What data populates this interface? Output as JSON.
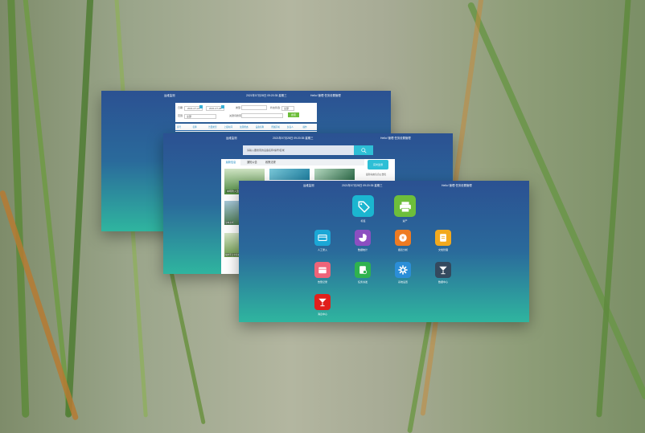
{
  "windows": {
    "back": {
      "brand": "运维监测",
      "datetime": "2021年07月28日 09:20:35 星期三",
      "user": "Hello! 管理  任务设置管理",
      "filters": {
        "date_label": "日期:",
        "date_from": "2021-07-21",
        "date_to": "2021-07-28",
        "type_label": "类型:",
        "status_label": "状态筛选:",
        "status_value": "全部",
        "scope_label": "范围:",
        "scope_value": "全部",
        "keyword_label": "关键词搜索:",
        "search_button": "搜索"
      },
      "columns": [
        "序号",
        "名称",
        "告警类型",
        "上报时间",
        "处理状态",
        "设备名称",
        "所属区域",
        "负责人",
        "操作"
      ]
    },
    "middle": {
      "brand": "运维监测",
      "datetime": "2021年07月28日 09:20:35 星期三",
      "user": "Hello! 管理  任务设置管理",
      "search_placeholder": "请输入要搜索的设备名称/编号/区域",
      "tabs": [
        "最新信息",
        "通知公告",
        "政策法规"
      ],
      "side_badge": "实时监测",
      "side_caption": "最新动态信息公告栏",
      "news_captions": [
        "林场防火监测",
        "湿地巡查",
        "保护区日常巡护"
      ]
    },
    "front": {
      "brand": "运维监测",
      "datetime": "2021年07月28日 09:20:35 星期三",
      "user": "Hello! 管理  任务设置管理",
      "tiles": [
        {
          "label": "标签",
          "color": "#1bb6d0",
          "icon": "tag-icon"
        },
        {
          "label": "资产",
          "color": "#6dbe3b",
          "icon": "printer-icon"
        },
        {
          "label": "人工录入",
          "color": "#1ba7d6",
          "icon": "card-icon"
        },
        {
          "label": "数据统计",
          "color": "#8c4fc1",
          "icon": "pie-chart-icon"
        },
        {
          "label": "报表分析",
          "color": "#ee7b22",
          "icon": "coin-icon"
        },
        {
          "label": "文档管理",
          "color": "#f2a91e",
          "icon": "document-icon"
        },
        {
          "label": "告警记录",
          "color": "#ee6479",
          "icon": "calendar-icon"
        },
        {
          "label": "任务派发",
          "color": "#2fb24f",
          "icon": "task-icon"
        },
        {
          "label": "系统设置",
          "color": "#2b8ed8",
          "icon": "gear-icon"
        },
        {
          "label": "数据中心",
          "color": "#34495e",
          "icon": "cocktail-icon"
        },
        {
          "label": "消息中心",
          "color": "#e0201b",
          "icon": "cocktail-icon"
        }
      ]
    }
  }
}
